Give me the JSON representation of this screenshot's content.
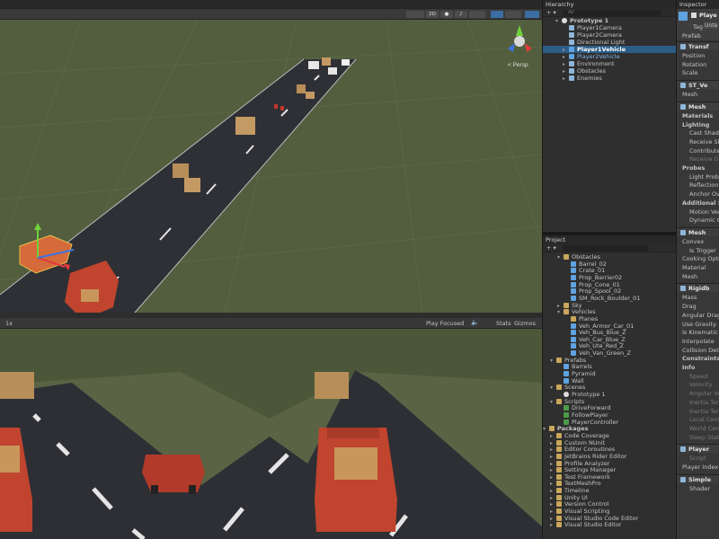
{
  "scene": {
    "toolbar_2d": "2D",
    "persp_label": "< Persp"
  },
  "game": {
    "scale_label": "1x",
    "play_mode": "Play Focused",
    "stats": "Stats",
    "gizmos": "Gizmos"
  },
  "hierarchy": {
    "title": "Hierarchy",
    "search": "All",
    "items": [
      {
        "label": "Prototype 1",
        "depth": 0,
        "icon": "scene",
        "arrow": "▾"
      },
      {
        "label": "Player1Camera",
        "depth": 1,
        "icon": "obj",
        "arrow": ""
      },
      {
        "label": "Player2Camera",
        "depth": 1,
        "icon": "obj",
        "arrow": ""
      },
      {
        "label": "Directional Light",
        "depth": 1,
        "icon": "obj",
        "arrow": ""
      },
      {
        "label": "Player1Vehicle",
        "depth": 1,
        "icon": "pre",
        "arrow": "▸",
        "selected": true
      },
      {
        "label": "Player2Vehicle",
        "depth": 1,
        "icon": "pre",
        "arrow": "▸",
        "prefab": true
      },
      {
        "label": "Environment",
        "depth": 1,
        "icon": "obj",
        "arrow": "▸"
      },
      {
        "label": "Obstacles",
        "depth": 1,
        "icon": "obj",
        "arrow": "▸"
      },
      {
        "label": "Enemies",
        "depth": 1,
        "icon": "obj",
        "arrow": "▸"
      }
    ]
  },
  "project": {
    "title": "Project",
    "items": [
      {
        "label": "Obstacles",
        "depth": 1,
        "icon": "folder",
        "arrow": "▾"
      },
      {
        "label": "Barrel_02",
        "depth": 2,
        "icon": "pre",
        "arrow": ""
      },
      {
        "label": "Crate_01",
        "depth": 2,
        "icon": "pre",
        "arrow": ""
      },
      {
        "label": "Prop_Barrier02",
        "depth": 2,
        "icon": "pre",
        "arrow": ""
      },
      {
        "label": "Prop_Cone_01",
        "depth": 2,
        "icon": "pre",
        "arrow": ""
      },
      {
        "label": "Prop_Spool_02",
        "depth": 2,
        "icon": "pre",
        "arrow": ""
      },
      {
        "label": "SM_Rock_Boulder_01",
        "depth": 2,
        "icon": "pre",
        "arrow": ""
      },
      {
        "label": "Sky",
        "depth": 1,
        "icon": "folder",
        "arrow": "▸"
      },
      {
        "label": "Vehicles",
        "depth": 1,
        "icon": "folder",
        "arrow": "▾"
      },
      {
        "label": "Planes",
        "depth": 2,
        "icon": "folder",
        "arrow": ""
      },
      {
        "label": "Veh_Armor_Car_01",
        "depth": 2,
        "icon": "pre",
        "arrow": ""
      },
      {
        "label": "Veh_Bus_Blue_Z",
        "depth": 2,
        "icon": "pre",
        "arrow": ""
      },
      {
        "label": "Veh_Car_Blue_Z",
        "depth": 2,
        "icon": "pre",
        "arrow": ""
      },
      {
        "label": "Veh_Ute_Red_Z",
        "depth": 2,
        "icon": "pre",
        "arrow": ""
      },
      {
        "label": "Veh_Van_Green_Z",
        "depth": 2,
        "icon": "pre",
        "arrow": ""
      },
      {
        "label": "Prefabs",
        "depth": 0,
        "icon": "folder",
        "arrow": "▾"
      },
      {
        "label": "Barrels",
        "depth": 1,
        "icon": "pre",
        "arrow": ""
      },
      {
        "label": "Pyramid",
        "depth": 1,
        "icon": "pre",
        "arrow": ""
      },
      {
        "label": "Wall",
        "depth": 1,
        "icon": "pre",
        "arrow": ""
      },
      {
        "label": "Scenes",
        "depth": 0,
        "icon": "folder",
        "arrow": "▾"
      },
      {
        "label": "Prototype 1",
        "depth": 1,
        "icon": "scene",
        "arrow": ""
      },
      {
        "label": "Scripts",
        "depth": 0,
        "icon": "folder",
        "arrow": "▾"
      },
      {
        "label": "DriveForward",
        "depth": 1,
        "icon": "cs",
        "arrow": ""
      },
      {
        "label": "FollowPlayer",
        "depth": 1,
        "icon": "cs",
        "arrow": ""
      },
      {
        "label": "PlayerController",
        "depth": 1,
        "icon": "cs",
        "arrow": ""
      },
      {
        "label": "Packages",
        "depth": -1,
        "icon": "folder",
        "arrow": "▾"
      },
      {
        "label": "Code Coverage",
        "depth": 0,
        "icon": "folder",
        "arrow": "▸"
      },
      {
        "label": "Custom NUnit",
        "depth": 0,
        "icon": "folder",
        "arrow": "▸"
      },
      {
        "label": "Editor Coroutines",
        "depth": 0,
        "icon": "folder",
        "arrow": "▸"
      },
      {
        "label": "JetBrains Rider Editor",
        "depth": 0,
        "icon": "folder",
        "arrow": "▸"
      },
      {
        "label": "Profile Analyzer",
        "depth": 0,
        "icon": "folder",
        "arrow": "▸"
      },
      {
        "label": "Settings Manager",
        "depth": 0,
        "icon": "folder",
        "arrow": "▸"
      },
      {
        "label": "Test Framework",
        "depth": 0,
        "icon": "folder",
        "arrow": "▸"
      },
      {
        "label": "TextMeshPro",
        "depth": 0,
        "icon": "folder",
        "arrow": "▸"
      },
      {
        "label": "Timeline",
        "depth": 0,
        "icon": "folder",
        "arrow": "▸"
      },
      {
        "label": "Unity UI",
        "depth": 0,
        "icon": "folder",
        "arrow": "▸"
      },
      {
        "label": "Version Control",
        "depth": 0,
        "icon": "folder",
        "arrow": "▸"
      },
      {
        "label": "Visual Scripting",
        "depth": 0,
        "icon": "folder",
        "arrow": "▸"
      },
      {
        "label": "Visual Studio Code Editor",
        "depth": 0,
        "icon": "folder",
        "arrow": "▸"
      },
      {
        "label": "Visual Studio Editor",
        "depth": 0,
        "icon": "folder",
        "arrow": "▸"
      }
    ]
  },
  "inspector": {
    "title": "Inspector",
    "object_name": "Playe",
    "tag_label": "Tag",
    "tag_value": "Unta",
    "prefab_label": "Prefab",
    "entries": [
      {
        "kind": "section",
        "label": "Transf"
      },
      {
        "kind": "label",
        "label": "Position"
      },
      {
        "kind": "label",
        "label": "Rotation"
      },
      {
        "kind": "label",
        "label": "Scale"
      },
      {
        "kind": "section",
        "label": "ST_Ve"
      },
      {
        "kind": "label",
        "label": "Mesh"
      },
      {
        "kind": "section",
        "label": "Mesh"
      },
      {
        "kind": "bold",
        "label": "Materials"
      },
      {
        "kind": "bold",
        "label": "Lighting"
      },
      {
        "kind": "sub",
        "label": "Cast Shado"
      },
      {
        "kind": "sub",
        "label": "Receive Sha"
      },
      {
        "kind": "sub",
        "label": "Contribute"
      },
      {
        "kind": "subgray",
        "label": "Receive Gl"
      },
      {
        "kind": "bold",
        "label": "Probes"
      },
      {
        "kind": "sub",
        "label": "Light Probe"
      },
      {
        "kind": "sub",
        "label": "Reflection"
      },
      {
        "kind": "sub",
        "label": "Anchor Ove"
      },
      {
        "kind": "bold",
        "label": "Additional Se"
      },
      {
        "kind": "sub",
        "label": "Motion Vec"
      },
      {
        "kind": "sub",
        "label": "Dynamic Oc"
      },
      {
        "kind": "section",
        "label": "Mesh"
      },
      {
        "kind": "label",
        "label": "Convex"
      },
      {
        "kind": "sub",
        "label": "Is Trigger"
      },
      {
        "kind": "label",
        "label": "Cooking Optio"
      },
      {
        "kind": "label",
        "label": "Material"
      },
      {
        "kind": "label",
        "label": "Mesh"
      },
      {
        "kind": "section",
        "label": "Rigidb"
      },
      {
        "kind": "label",
        "label": "Mass"
      },
      {
        "kind": "label",
        "label": "Drag"
      },
      {
        "kind": "label",
        "label": "Angular Drag"
      },
      {
        "kind": "label",
        "label": "Use Gravity"
      },
      {
        "kind": "label",
        "label": "Is Kinematic"
      },
      {
        "kind": "label",
        "label": "Interpolate"
      },
      {
        "kind": "label",
        "label": "Collision Dete"
      },
      {
        "kind": "bold",
        "label": "Constraints"
      },
      {
        "kind": "bold",
        "label": "Info"
      },
      {
        "kind": "subgray",
        "label": "Speed"
      },
      {
        "kind": "subgray",
        "label": "Velocity"
      },
      {
        "kind": "subgray",
        "label": "Angular Veloc"
      },
      {
        "kind": "subgray",
        "label": "Inertia Tensor"
      },
      {
        "kind": "subgray",
        "label": "Inertia Tensor"
      },
      {
        "kind": "subgray",
        "label": "Local Center"
      },
      {
        "kind": "subgray",
        "label": "World Center"
      },
      {
        "kind": "subgray",
        "label": "Sleep State"
      },
      {
        "kind": "section",
        "label": "Player"
      },
      {
        "kind": "subgray",
        "label": "Script"
      },
      {
        "kind": "label",
        "label": "Player Index"
      },
      {
        "kind": "section2",
        "label": "Simple"
      },
      {
        "kind": "sub",
        "label": "Shader"
      }
    ]
  }
}
